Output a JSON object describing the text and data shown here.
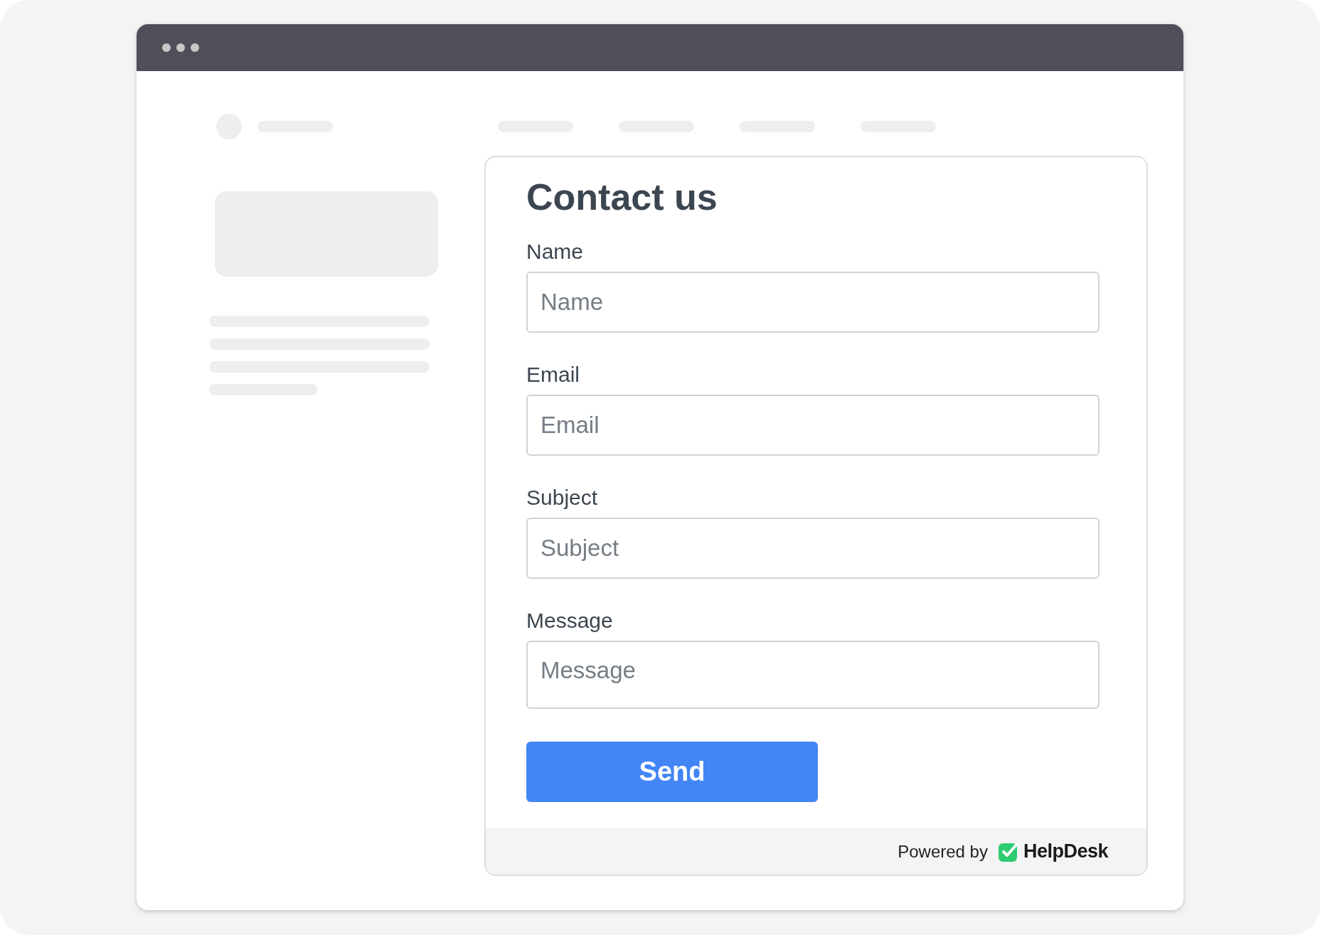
{
  "form": {
    "title": "Contact us",
    "fields": [
      {
        "kind": "input",
        "label": "Name",
        "placeholder": "Name"
      },
      {
        "kind": "input",
        "label": "Email",
        "placeholder": "Email"
      },
      {
        "kind": "input",
        "label": "Subject",
        "placeholder": "Subject"
      },
      {
        "kind": "textarea",
        "label": "Message",
        "placeholder": "Message"
      }
    ],
    "submit": "Send"
  },
  "footer": {
    "powered_by": "Powered by",
    "brand": "HelpDesk"
  }
}
